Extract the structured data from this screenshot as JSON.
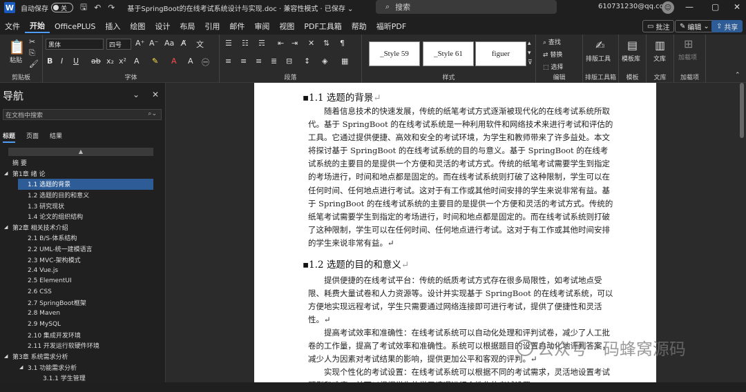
{
  "titlebar": {
    "logo": "W",
    "autosave_label": "自动保存",
    "autosave_state": "关",
    "save_icon": "🖫",
    "undo_icon": "↶",
    "redo_icon": "↷",
    "doc_title": "基于SpringBoot的在线考试系统设计与实现.doc · 兼容性模式 · 已保存 ⌄",
    "search_placeholder": "搜索",
    "user_email": "610731230@qq.com",
    "minimize": "—",
    "maximize": "▢",
    "close": "✕"
  },
  "menu": {
    "items": [
      "文件",
      "开始",
      "OfficePLUS",
      "插入",
      "绘图",
      "设计",
      "布局",
      "引用",
      "邮件",
      "审阅",
      "视图",
      "PDF工具箱",
      "帮助",
      "福昕PDF"
    ],
    "comment_btn": "批注",
    "edit_btn": "编辑",
    "share_btn": "共享"
  },
  "ribbon": {
    "paste_label": "粘贴",
    "clipboard_label": "剪贴板",
    "font_name": "黑体",
    "font_size": "四号",
    "font_label": "字体",
    "paragraph_label": "段落",
    "styles": [
      "_Style 59",
      "_Style 61",
      "figuer"
    ],
    "styles_label": "样式",
    "find_label": "查找",
    "replace_label": "替换",
    "select_label": "选择",
    "edit_label": "编辑",
    "layout_tool_label": "排版工具",
    "layout_tool_group": "排版工具箱",
    "template_label": "模板库",
    "template_group": "模板",
    "library_label": "文库",
    "library_group": "文库",
    "addin_label": "加载项",
    "addin_btn_label": "加载项"
  },
  "nav": {
    "title": "导航",
    "search_placeholder": "在文档中搜索",
    "tabs": [
      "标题",
      "页面",
      "结果"
    ],
    "items": [
      {
        "text": "摘 要",
        "indent": 0,
        "arrow": ""
      },
      {
        "text": "第1章 绪 论",
        "indent": 0,
        "arrow": "◢"
      },
      {
        "text": "1.1 选题的背景",
        "indent": 1,
        "arrow": "",
        "selected": true
      },
      {
        "text": "1.2 选题的目的和意义",
        "indent": 1,
        "arrow": ""
      },
      {
        "text": "1.3 研究现状",
        "indent": 1,
        "arrow": ""
      },
      {
        "text": "1.4 论文的组织结构",
        "indent": 1,
        "arrow": ""
      },
      {
        "text": "第2章 相关技术介绍",
        "indent": 0,
        "arrow": "◢"
      },
      {
        "text": "2.1 B/S-体系结构",
        "indent": 1,
        "arrow": ""
      },
      {
        "text": "2.2 UML-统一建模语言",
        "indent": 1,
        "arrow": ""
      },
      {
        "text": "2.3 MVC-架构模式",
        "indent": 1,
        "arrow": ""
      },
      {
        "text": "2.4 Vue.js",
        "indent": 1,
        "arrow": ""
      },
      {
        "text": "2.5 ElementUI",
        "indent": 1,
        "arrow": ""
      },
      {
        "text": "2.6 CSS",
        "indent": 1,
        "arrow": ""
      },
      {
        "text": "2.7 SpringBoot框架",
        "indent": 1,
        "arrow": ""
      },
      {
        "text": "2.8 Maven",
        "indent": 1,
        "arrow": ""
      },
      {
        "text": "2.9 MySQL",
        "indent": 1,
        "arrow": ""
      },
      {
        "text": "2.10 集成开发环境",
        "indent": 1,
        "arrow": ""
      },
      {
        "text": "2.11 开发运行软硬件环境",
        "indent": 1,
        "arrow": ""
      },
      {
        "text": "第3章 系统需求分析",
        "indent": 0,
        "arrow": "◢"
      },
      {
        "text": "3.1 功能需求分析",
        "indent": 1,
        "arrow": "◢"
      },
      {
        "text": "3.1.1 学生管理",
        "indent": 2,
        "arrow": ""
      }
    ]
  },
  "document": {
    "h1": "1.1   选题的背景",
    "p1": "随着信息技术的快速发展，传统的纸笔考试方式逐渐被现代化的在线考试系统所取代。基于 SpringBoot 的在线考试系统是一种利用软件和网络技术来进行考试和评估的工具。它通过提供便捷、高效和安全的考试环境，为学生和教师带来了许多益处。本文将探讨基于 SpringBoot 的在线考试系统的目的与意义。基于 SpringBoot 的在线考试系统的主要目的是提供一个方便和灵活的考试方式。传统的纸笔考试需要学生到指定的考场进行，时间和地点都是固定的。而在线考试系统则打破了这种限制，学生可以在任何时间、任何地点进行考试。这对于有工作或其他时间安排的学生来说非常有益。基于 SpringBoot 的在线考试系统的主要目的是提供一个方便和灵活的考试方式。传统的纸笔考试需要学生到指定的考场进行，时间和地点都是固定的。而在线考试系统则打破了这种限制，学生可以在任何时间、任何地点进行考试。这对于有工作或其他时间安排的学生来说非常有益。↵",
    "h2": "1.2   选题的目的和意义",
    "p2": "提供便捷的在线考试平台：传统的纸质考试方式存在很多局限性，如考试地点受限、耗费大量试卷和人力资源等。设计并实现基于 SpringBoot 的在线考试系统，可以方便地实现远程考试，学生只需要通过网络连接即可进行考试，提供了便捷性和灵活性。↵",
    "p3": "提高考试效率和准确性：在线考试系统可以自动化处理和评判试卷，减少了人工批卷的工作量，提高了考试效率和准确性。系统可以根据题目的设置自动化地评判答案，减少人为因素对考试结果的影响，提供更加公平和客观的评判。↵",
    "p4": "实现个性化的考试设置：在线考试系统可以根据不同的考试需求，灵活地设置考试题型和难度，并可以根据学生的学习情况进行个性化的考试设置。"
  },
  "watermark": "公众号 · 码蜂窝源码"
}
